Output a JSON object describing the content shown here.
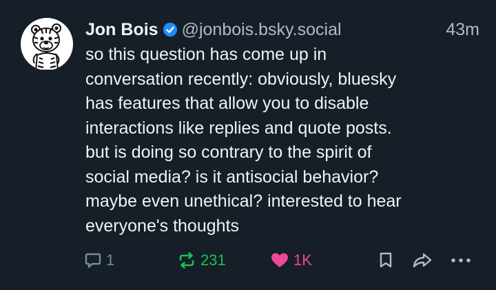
{
  "post": {
    "author": {
      "display_name": "Jon Bois",
      "handle": "@jonbois.bsky.social",
      "verified": true,
      "avatar_icon": "cartoon-tiger-avatar"
    },
    "timestamp": "43m",
    "text": "so this question has come up in\nconversation recently: obviously, bluesky\nhas features that allow you to disable\ninteractions like replies and quote posts.\nbut is doing so contrary to the spirit of\nsocial media? is it antisocial behavior?\nmaybe even unethical? interested to hear\neveryone's thoughts",
    "actions": {
      "reply": {
        "icon": "reply-icon",
        "count": "1"
      },
      "repost": {
        "icon": "repost-icon",
        "count": "231"
      },
      "like": {
        "icon": "heart-icon",
        "count": "1K",
        "liked": true
      },
      "bookmark": {
        "icon": "bookmark-icon"
      },
      "share": {
        "icon": "share-icon"
      },
      "more": {
        "icon": "more-options-icon"
      }
    }
  },
  "colors": {
    "background": "#161e27",
    "text": "#f1f3f5",
    "muted": "#aebbc9",
    "verified": "#208bfe",
    "repost": "#19c25b",
    "like": "#ec4899",
    "icon_muted": "#788da3"
  }
}
